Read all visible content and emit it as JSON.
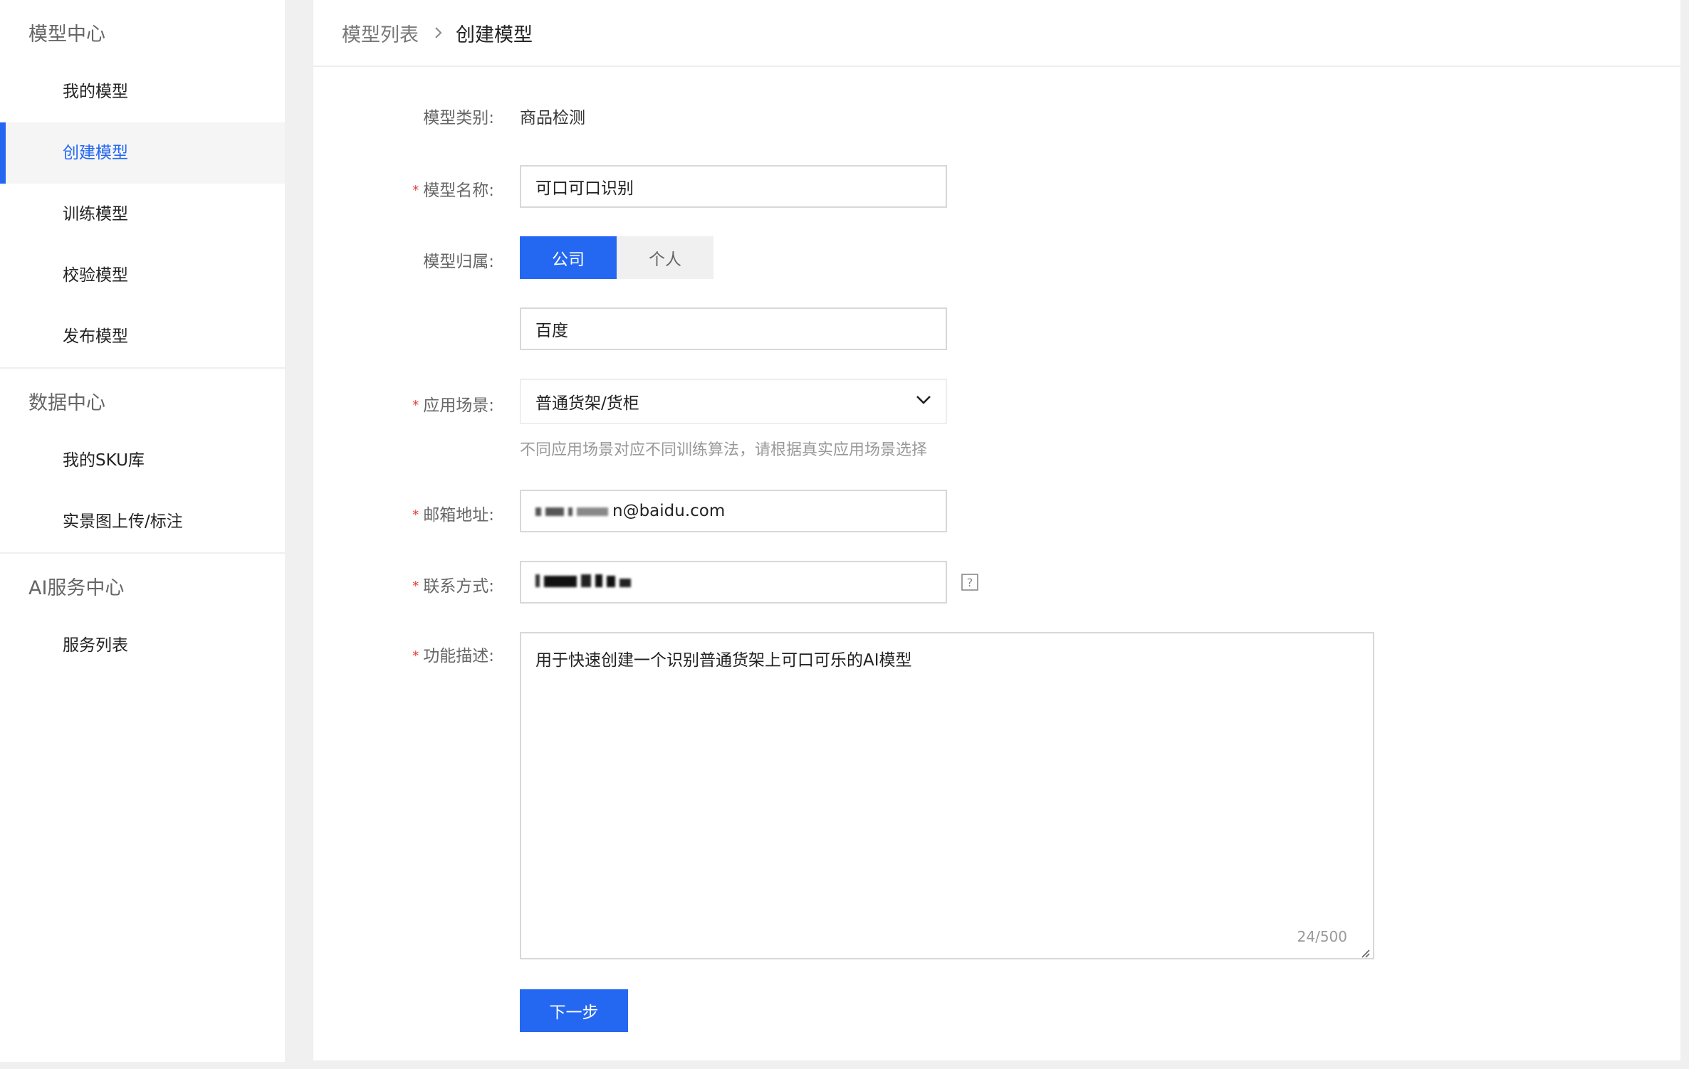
{
  "sidebar": {
    "groups": [
      {
        "title": "模型中心",
        "items": [
          "我的模型",
          "创建模型",
          "训练模型",
          "校验模型",
          "发布模型"
        ]
      },
      {
        "title": "数据中心",
        "items": [
          "我的SKU库",
          "实景图上传/标注"
        ]
      },
      {
        "title": "AI服务中心",
        "items": [
          "服务列表"
        ]
      }
    ],
    "active_item": "创建模型"
  },
  "breadcrumb": {
    "parent": "模型列表",
    "current": "创建模型"
  },
  "form": {
    "category": {
      "label": "模型类别:",
      "value": "商品检测"
    },
    "name": {
      "label": "模型名称:",
      "value": "可口可口识别"
    },
    "ownership": {
      "label": "模型归属:",
      "options": [
        "公司",
        "个人"
      ],
      "selected": "公司",
      "company_value": "百度"
    },
    "scene": {
      "label": "应用场景:",
      "value": "普通货架/货柜",
      "hint": "不同应用场景对应不同训练算法，请根据真实应用场景选择"
    },
    "email": {
      "label": "邮箱地址:",
      "visible_suffix": "n@baidu.com"
    },
    "contact": {
      "label": "联系方式:"
    },
    "description": {
      "label": "功能描述:",
      "value": "用于快速创建一个识别普通货架上可口可乐的AI模型",
      "counter": "24/500"
    },
    "next_label": "下一步"
  },
  "colors": {
    "accent": "#2468f2",
    "required": "#e53935"
  }
}
